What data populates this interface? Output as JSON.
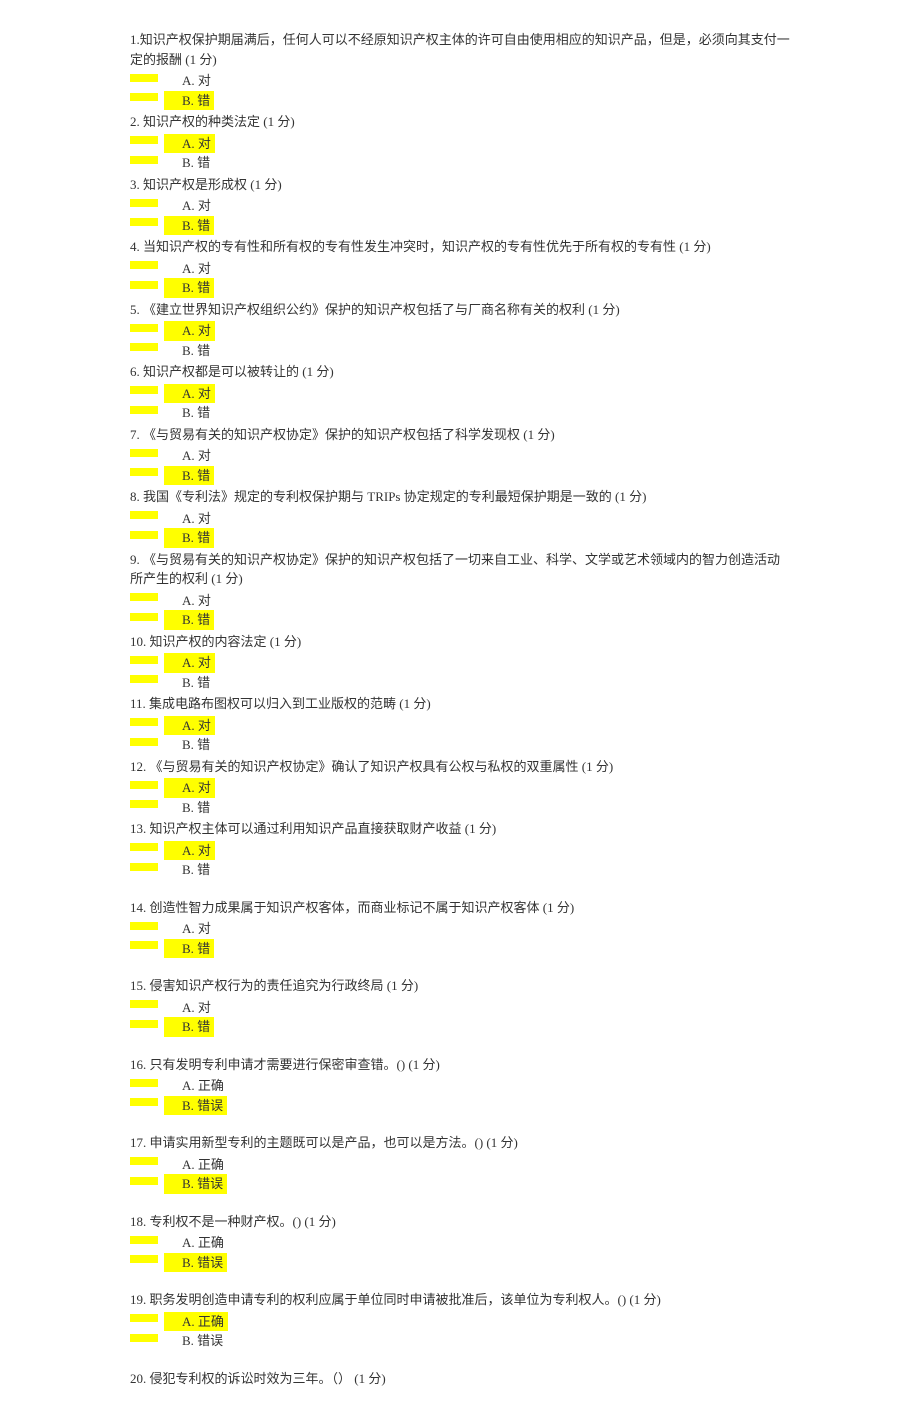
{
  "points_label": "(1 分)",
  "opt_a_true": "A. 对",
  "opt_b_false": "B. 错",
  "opt_a_correct": "A. 正确",
  "opt_b_incorrect": "B. 错误",
  "questions": [
    {
      "num": "1.",
      "text": "知识产权保护期届满后，任何人可以不经原知识产权主体的许可自由使用相应的知识产品，但是，必须向其支付一定的报酬",
      "suffix": "  ",
      "highlight": "B",
      "opts": "tf"
    },
    {
      "num": "2.",
      "text": " 知识产权的种类法定",
      "suffix": "   ",
      "highlight": "A",
      "opts": "tf"
    },
    {
      "num": "3.",
      "text": " 知识产权是形成权",
      "suffix": "   ",
      "highlight": "B",
      "opts": "tf"
    },
    {
      "num": "4.",
      "text": " 当知识产权的专有性和所有权的专有性发生冲突时，知识产权的专有性优先于所有权的专有性",
      "suffix": "   ",
      "highlight": "B",
      "opts": "tf"
    },
    {
      "num": "5.",
      "text": " 《建立世界知识产权组织公约》保护的知识产权包括了与厂商名称有关的权利",
      "suffix": "   ",
      "highlight": "A",
      "opts": "tf"
    },
    {
      "num": "6.",
      "text": " 知识产权都是可以被转让的",
      "suffix": "   ",
      "highlight": "A",
      "opts": "tf"
    },
    {
      "num": "7.",
      "text": " 《与贸易有关的知识产权协定》保护的知识产权包括了科学发现权",
      "suffix": "   ",
      "highlight": "B",
      "opts": "tf"
    },
    {
      "num": "8.",
      "text": " 我国《专利法》规定的专利权保护期与 TRIPs 协定规定的专利最短保护期是一致的",
      "suffix": "   ",
      "highlight": "B",
      "opts": "tf"
    },
    {
      "num": "9.",
      "text": " 《与贸易有关的知识产权协定》保护的知识产权包括了一切来自工业、科学、文学或艺术领域内的智力创造活动所产生的权利",
      "suffix": "   ",
      "highlight": "B",
      "opts": "tf"
    },
    {
      "num": "10.",
      "text": " 知识产权的内容法定",
      "suffix": "   ",
      "highlight": "A",
      "opts": "tf"
    },
    {
      "num": "11.",
      "text": " 集成电路布图权可以归入到工业版权的范畴",
      "suffix": "   ",
      "highlight": "A",
      "opts": "tf"
    },
    {
      "num": "12.",
      "text": " 《与贸易有关的知识产权协定》确认了知识产权具有公权与私权的双重属性",
      "suffix": "   ",
      "highlight": "A",
      "opts": "tf"
    },
    {
      "num": "13.",
      "text": " 知识产权主体可以通过利用知识产品直接获取财产收益",
      "suffix": "   ",
      "highlight": "A",
      "opts": "tf",
      "gap_after": true
    },
    {
      "num": "14.",
      "text": " 创造性智力成果属于知识产权客体，而商业标记不属于知识产权客体",
      "suffix": "   ",
      "highlight": "B",
      "opts": "tf",
      "gap_after": true
    },
    {
      "num": "15.",
      "text": " 侵害知识产权行为的责任追究为行政终局",
      "suffix": "   ",
      "highlight": "B",
      "opts": "tf",
      "gap_after": true
    },
    {
      "num": "16.",
      "text": " 只有发明专利申请才需要进行保密审查错。()",
      "suffix": "   ",
      "highlight": "B",
      "opts": "ci",
      "gap_after": true
    },
    {
      "num": "17.",
      "text": " 申请实用新型专利的主题既可以是产品，也可以是方法。()",
      "suffix": "   ",
      "highlight": "B",
      "opts": "ci",
      "gap_after": true
    },
    {
      "num": "18.",
      "text": " 专利权不是一种财产权。()",
      "suffix": "   ",
      "highlight": "B",
      "opts": "ci",
      "gap_after": true
    },
    {
      "num": "19.",
      "text": " 职务发明创造申请专利的权利应属于单位同时申请被批准后，该单位为专利权人。()",
      "suffix": "   ",
      "highlight": "A",
      "opts": "ci",
      "gap_after": true
    },
    {
      "num": "20.",
      "text": " 侵犯专利权的诉讼时效为三年。（）",
      "suffix": "   ",
      "highlight": "",
      "opts": "none"
    }
  ]
}
